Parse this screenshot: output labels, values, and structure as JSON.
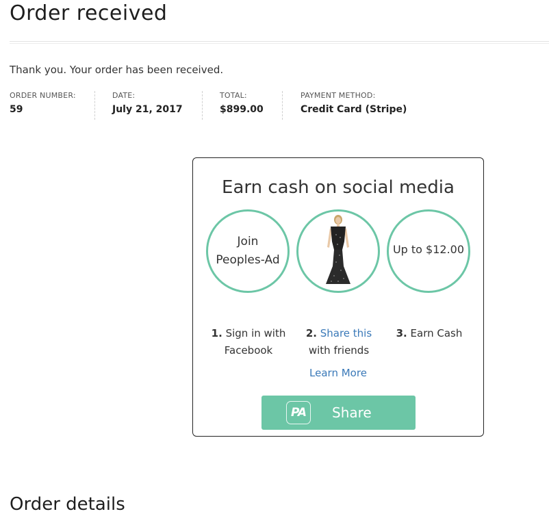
{
  "page": {
    "title": "Order received"
  },
  "thank_you": "Thank you. Your order has been received.",
  "overview": [
    {
      "label": "ORDER NUMBER:",
      "value": "59"
    },
    {
      "label": "DATE:",
      "value": "July 21, 2017"
    },
    {
      "label": "TOTAL:",
      "value": "$899.00"
    },
    {
      "label": "PAYMENT METHOD:",
      "value": "Credit Card (Stripe)"
    }
  ],
  "promo": {
    "title": "Earn cash on social media",
    "circle_join_line1": "Join",
    "circle_join_line2": "Peoples-Ad",
    "circle_earn": "Up to $12.00",
    "step1_num": "1.",
    "step1_line1": "Sign in with",
    "step1_line2": "Facebook",
    "step2_num": "2.",
    "step2_link": "Share this",
    "step2_line2": "with friends",
    "step3_num": "3.",
    "step3_text": "Earn Cash",
    "learn_more": "Learn More",
    "share_icon_text": "PA",
    "share_label": "Share",
    "accent_color": "#6cc6a6",
    "link_color": "#3a79b8"
  },
  "order_details": {
    "title": "Order details"
  }
}
